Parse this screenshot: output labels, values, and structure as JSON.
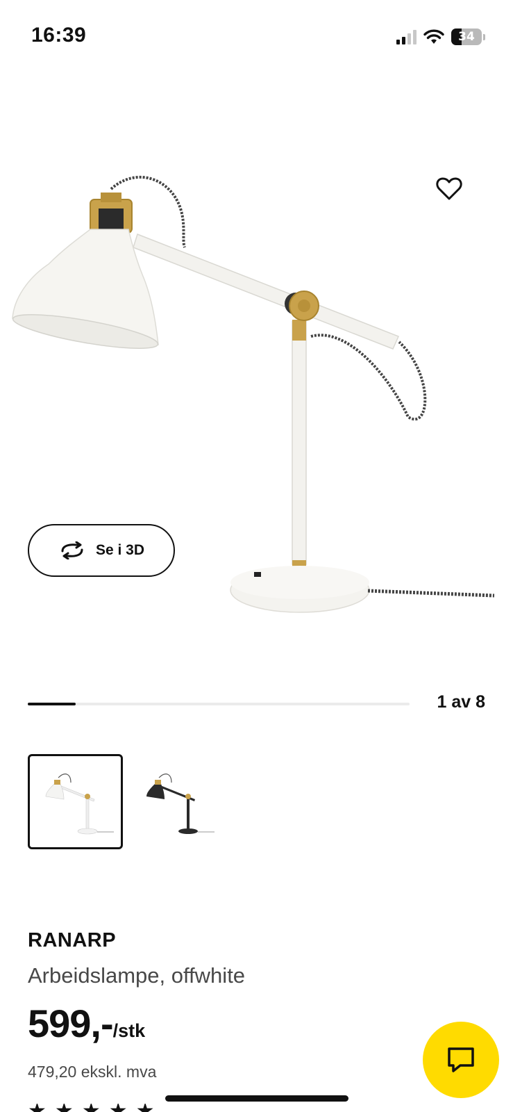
{
  "status_bar": {
    "time": "16:39",
    "battery_level": "34",
    "icons": [
      "cellular-signal-icon",
      "wifi-icon",
      "battery-icon"
    ]
  },
  "gallery": {
    "favorite_icon": "heart-icon",
    "view_3d_label": "Se i 3D",
    "view_3d_icon": "rotate-3d-icon",
    "counter": "1 av 8",
    "progress": 0.125,
    "thumbnails": [
      {
        "variant": "offwhite",
        "selected": true
      },
      {
        "variant": "black",
        "selected": false
      }
    ]
  },
  "product": {
    "name": "RANARP",
    "description": "Arbeidslampe, offwhite",
    "price": "599,-",
    "price_unit": "/stk",
    "price_ex_vat": "479,20 ekskl. mva",
    "rating_stars": 5
  },
  "chat": {
    "icon": "chat-bubble-icon",
    "color": "#ffdb00"
  },
  "colors": {
    "accent_yellow": "#ffdb00",
    "text": "#111111",
    "secondary_text": "#484848",
    "brass": "#c9a24b"
  }
}
